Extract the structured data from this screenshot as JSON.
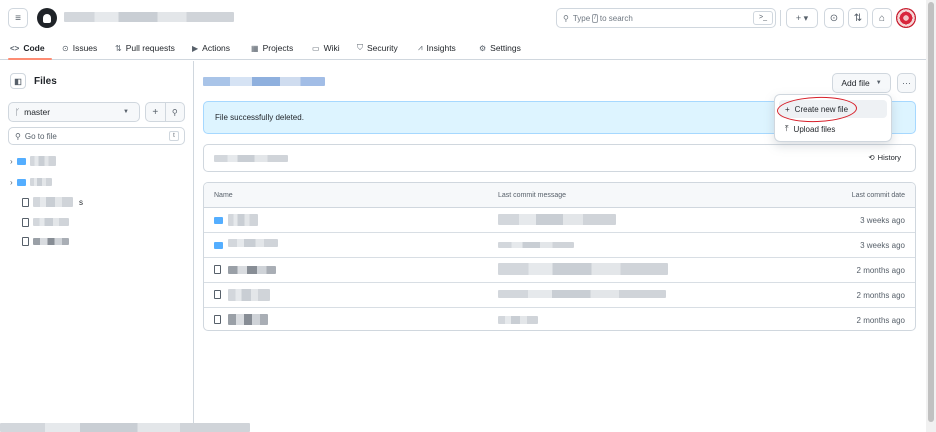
{
  "header": {
    "search_placeholder_prefix": "Type",
    "search_key": "/",
    "search_placeholder_suffix": "to search",
    "command_palette": ">_",
    "new_button": "+ ▾"
  },
  "repo_nav": {
    "tabs": [
      {
        "label": "Code",
        "icon": "<>"
      },
      {
        "label": "Issues",
        "icon": "⊙"
      },
      {
        "label": "Pull requests",
        "icon": "⇅"
      },
      {
        "label": "Actions",
        "icon": "▶"
      },
      {
        "label": "Projects",
        "icon": "▦"
      },
      {
        "label": "Wiki",
        "icon": "▭"
      },
      {
        "label": "Security",
        "icon": "⛉"
      },
      {
        "label": "Insights",
        "icon": "⩘"
      },
      {
        "label": "Settings",
        "icon": "⚙"
      }
    ]
  },
  "sidebar": {
    "title": "Files",
    "branch": "master",
    "go_to_file_placeholder": "Go to file",
    "go_to_file_key": "t",
    "visible_suffix": "s"
  },
  "main": {
    "add_file_label": "Add file",
    "more_label": "···",
    "flash_message": "File successfully deleted.",
    "history_label": "History",
    "table": {
      "col_name": "Name",
      "col_message": "Last commit message",
      "col_date": "Last commit date",
      "rows": [
        {
          "type": "folder",
          "date": "3 weeks ago"
        },
        {
          "type": "folder",
          "date": "3 weeks ago"
        },
        {
          "type": "file",
          "date": "2 months ago"
        },
        {
          "type": "file",
          "date": "2 months ago"
        },
        {
          "type": "file",
          "date": "2 months ago"
        }
      ]
    }
  },
  "dropdown": {
    "items": [
      {
        "label": "Create new file",
        "icon": "+"
      },
      {
        "label": "Upload files",
        "icon": "⤒"
      }
    ]
  },
  "colors": {
    "accent_underline": "#fd8c73",
    "flash_bg": "#ddf4ff",
    "folder": "#54aeff",
    "annotation": "#d7202a"
  }
}
